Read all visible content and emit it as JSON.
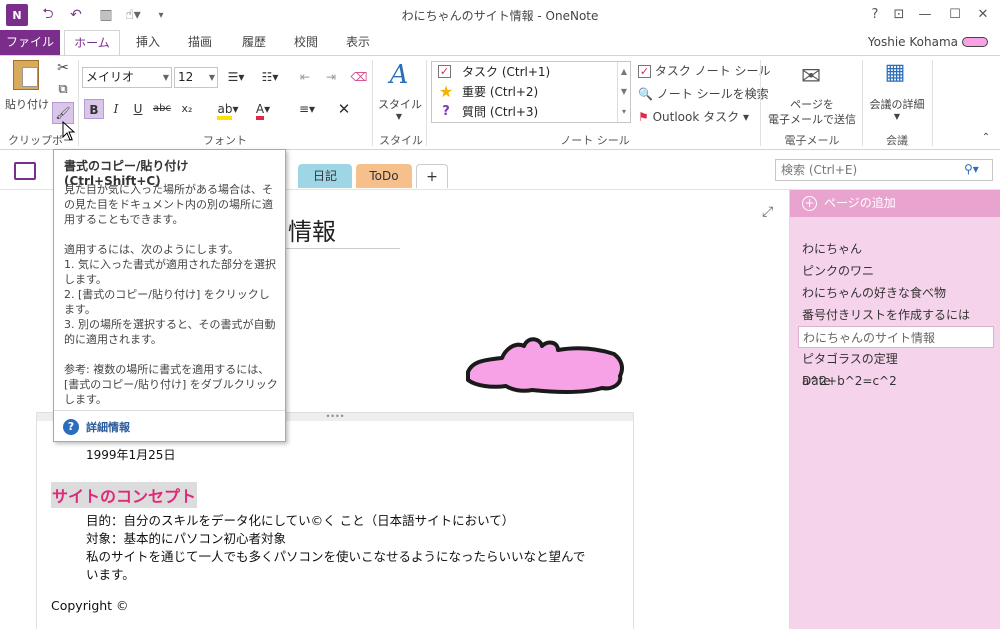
{
  "window": {
    "title": "わにちゃんのサイト情報 - OneNote",
    "help": "?",
    "minimize": "—",
    "maximize": "☐",
    "close": "✕"
  },
  "qat": {
    "back_icon": "back-icon",
    "undo_icon": "undo-icon"
  },
  "tabs": [
    {
      "label": "ファイル"
    },
    {
      "label": "ホーム"
    },
    {
      "label": "挿入"
    },
    {
      "label": "描画"
    },
    {
      "label": "履歴"
    },
    {
      "label": "校閲"
    },
    {
      "label": "表示"
    }
  ],
  "user": {
    "name": "Yoshie Kohama"
  },
  "ribbon": {
    "paste_label": "貼り付け",
    "clipboard_label": "クリップボー",
    "font_name": "メイリオ",
    "font_size": "12",
    "font_label": "フォント",
    "bold": "B",
    "italic": "I",
    "underline": "U",
    "strike": "abc",
    "subscript": "x₂",
    "style_label": "スタイル",
    "style_group_label": "スタイル",
    "tags": [
      {
        "label": "タスク (Ctrl+1)"
      },
      {
        "label": "重要 (Ctrl+2)"
      },
      {
        "label": "質問 (Ctrl+3)"
      }
    ],
    "todo_tag": "タスク ノート シール",
    "find_tags": "ノート シールを検索",
    "outlook_tasks": "Outlook タスク",
    "tags_group_label": "ノート シール",
    "email_label_1": "ページを",
    "email_label_2": "電子メールで送信",
    "email_group_label": "電子メール",
    "meeting_label": "会議の詳細",
    "meeting_group_label": "会議"
  },
  "sections": [
    {
      "label": "日記",
      "color": "#9fd6e5"
    },
    {
      "label": "ToDo",
      "color": "#f6c08d"
    },
    {
      "label": "+",
      "color": "#ffffff"
    }
  ],
  "search": {
    "placeholder": "検索 (Ctrl+E)"
  },
  "page": {
    "title_fragment": "情報",
    "date": "1999年1月25日",
    "heading": "サイトのコンセプト",
    "lines": [
      "目的：自分のスキルをデータ化にしてい©く こと（日本語サイトにおいて）",
      "対象：基本的にパソコン初心者対象",
      "私のサイトを通じて一人でも多くパソコンを使いこなせるようになったらいいなと望んで",
      "います。"
    ],
    "copyright": "Copyright ©"
  },
  "pages_pane": {
    "add_page": "ページの追加",
    "pages": [
      {
        "label": "わにちゃん"
      },
      {
        "label": "ピンクのワニ"
      },
      {
        "label": "わにちゃんの好きな食べ物"
      },
      {
        "label": "番号付きリストを作成するには"
      },
      {
        "label": "わにちゃんのサイト情報"
      },
      {
        "label": "ピタゴラスの定理　a^2+b^2=c^2"
      },
      {
        "label": "Date"
      }
    ]
  },
  "tooltip": {
    "title": "書式のコピー/貼り付け (Ctrl+Shift+C)",
    "p1": "見た目が気に入った場所がある場合は、その見た目をドキュメント内の別の場所に適用することもできます。",
    "p2": "適用するには、次のようにします。",
    "p3": "1. 気に入った書式が適用された部分を選択します。",
    "p4": "2. [書式のコピー/貼り付け] をクリックします。",
    "p5": "3. 別の場所を選択すると、その書式が自動的に適用されます。",
    "p6": "参考: 複数の場所に書式を適用するには、[書式のコピー/貼り付け] をダブルクリックします。",
    "more": "詳細情報"
  },
  "colors": {
    "accent": "#7b2d8b",
    "heading_pink": "#e0287a",
    "pane": "#f5d3ea",
    "pane_header": "#e8a4cf"
  }
}
